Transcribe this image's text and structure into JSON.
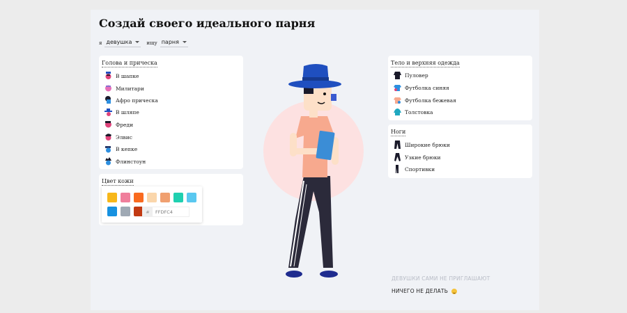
{
  "title": "Создай своего идеального парня",
  "filters": {
    "prefix": "я",
    "who_value": "девушка",
    "seek_label": "ищу",
    "target_value": "парня"
  },
  "head_panel": {
    "title": "Голова и прическа",
    "items": [
      {
        "label": "В шапке",
        "icon": "hat-hair-icon"
      },
      {
        "label": "Милитари",
        "icon": "military-hair-icon"
      },
      {
        "label": "Афро прическа",
        "icon": "afro-hair-icon"
      },
      {
        "label": "В шляпе",
        "icon": "fedora-hair-icon"
      },
      {
        "label": "Фреди",
        "icon": "freddie-hair-icon"
      },
      {
        "label": "Элвис",
        "icon": "elvis-hair-icon"
      },
      {
        "label": "В кепке",
        "icon": "cap-hair-icon"
      },
      {
        "label": "Флинстоун",
        "icon": "flintstone-hair-icon"
      }
    ]
  },
  "skin_panel": {
    "title": "Цвет кожи",
    "swatches": [
      "#f7b71a",
      "#f07f9c",
      "#f96a1f",
      "#fad6ab",
      "#f0a070",
      "#1fd0b0",
      "#5ac8f0",
      "#1791e0",
      "#9fa9b4",
      "#c23a12"
    ],
    "hex_prefix": "#",
    "hex_value": "FFDFC4"
  },
  "body_panel": {
    "title": "Тело и верхняя одежда",
    "items": [
      {
        "label": "Пуловер",
        "icon": "pullover-icon"
      },
      {
        "label": "Футболка синяя",
        "icon": "blue-tshirt-icon"
      },
      {
        "label": "Футболка бежевая",
        "icon": "beige-tshirt-icon"
      },
      {
        "label": "Толстовка",
        "icon": "hoodie-icon"
      }
    ]
  },
  "legs_panel": {
    "title": "Ноги",
    "items": [
      {
        "label": "Широкие брюки",
        "icon": "wide-pants-icon"
      },
      {
        "label": "Узкие брюки",
        "icon": "slim-pants-icon"
      },
      {
        "label": "Спортивки",
        "icon": "sweatpants-icon"
      }
    ]
  },
  "bottom": {
    "faded_text": "ДЕВУШКИ САМИ НЕ ПРИГЛАШАЮТ",
    "action_text": "НИЧЕГО НЕ ДЕЛАТЬ"
  },
  "colors": {
    "accent_blue": "#1f4fbf",
    "pants": "#2b2a3a",
    "shirt": "#f7a98e",
    "skin": "#fde0c8",
    "blush_circle": "#fde1e1"
  }
}
